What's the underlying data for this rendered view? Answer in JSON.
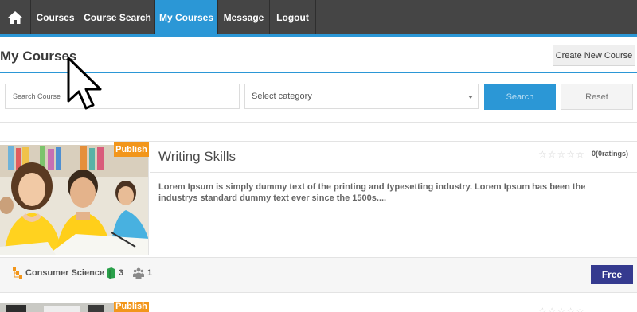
{
  "nav": {
    "home_icon": "home-icon",
    "items": [
      {
        "label": "Courses"
      },
      {
        "label": "Course Search"
      },
      {
        "label": "My Courses",
        "active": true
      },
      {
        "label": "Message"
      },
      {
        "label": "Logout"
      }
    ]
  },
  "colors": {
    "accent": "#2b97d6",
    "nav_bg": "#454545",
    "badge": "#f2961b",
    "free": "#353a8f"
  },
  "page": {
    "title": "My Courses",
    "create_label": "Create New Course"
  },
  "filters": {
    "search_placeholder": "Search Course",
    "category_placeholder": "Select category",
    "search_label": "Search",
    "reset_label": "Reset"
  },
  "courses": [
    {
      "status": "Publish",
      "title": "Writing Skills",
      "rating_stars": 0,
      "ratings_text": "0(0ratings)",
      "description": "Lorem Ipsum is simply dummy text of the printing and typesetting industry. Lorem Ipsum has been the industrys standard dummy text ever since the 1500s....",
      "category": "Consumer Science",
      "lessons": "3",
      "students": "1",
      "price": "Free"
    },
    {
      "status": "Publish"
    }
  ]
}
